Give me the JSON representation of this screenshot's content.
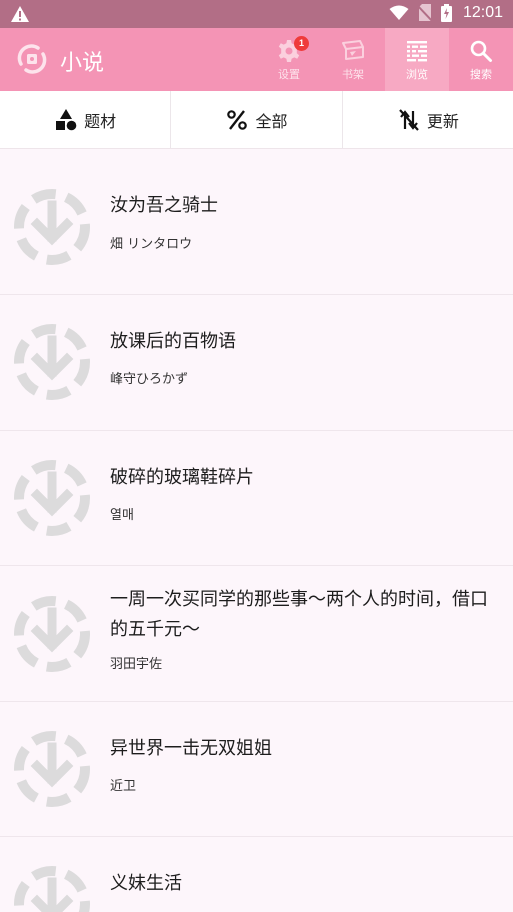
{
  "status_bar": {
    "time": "12:01",
    "icons": [
      "warning-icon",
      "wifi-icon",
      "sim-off-icon",
      "battery-charging-icon"
    ]
  },
  "app_bar": {
    "title": "小说",
    "logo_icon": "app-logo-icon",
    "actions": [
      {
        "label": "设置",
        "icon": "settings-gear-icon",
        "badge": "1"
      },
      {
        "label": "书架",
        "icon": "bookshelf-icon"
      },
      {
        "label": "浏览",
        "icon": "browse-grid-icon",
        "active": true
      },
      {
        "label": "搜索",
        "icon": "search-icon"
      }
    ]
  },
  "filters": [
    {
      "label": "题材",
      "icon": "shapes-icon"
    },
    {
      "label": "全部",
      "icon": "percent-icon"
    },
    {
      "label": "更新",
      "icon": "sort-icon"
    }
  ],
  "novels": [
    {
      "title": "汝为吾之骑士",
      "author": "畑 リンタロウ"
    },
    {
      "title": "放课后的百物语",
      "author": "峰守ひろかず"
    },
    {
      "title": "破碎的玻璃鞋碎片",
      "author": "열매"
    },
    {
      "title": "一周一次买同学的那些事～两个人的时间，借口的五千元～",
      "author": "羽田宇佐"
    },
    {
      "title": "异世界一击无双姐姐",
      "author": "近卫"
    },
    {
      "title": "义妹生活",
      "author": ""
    }
  ],
  "colors": {
    "status_bar": "#b26e86",
    "app_bar": "#f494b5",
    "active_tab": "#f7a9c3",
    "badge": "#ef3b3b",
    "placeholder": "#dcdbdc"
  }
}
